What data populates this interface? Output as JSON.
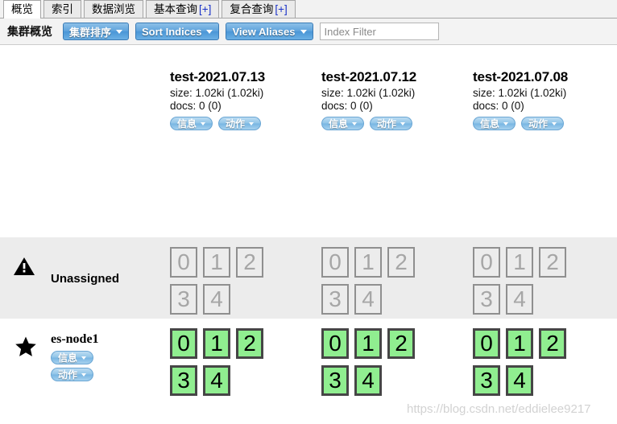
{
  "tabs": [
    {
      "label": "概览",
      "active": true,
      "plus": ""
    },
    {
      "label": "索引",
      "active": false,
      "plus": ""
    },
    {
      "label": "数据浏览",
      "active": false,
      "plus": ""
    },
    {
      "label": "基本查询",
      "active": false,
      "plus": "[+]"
    },
    {
      "label": "复合查询",
      "active": false,
      "plus": "[+]"
    }
  ],
  "toolbar": {
    "title": "集群概览",
    "buttons": [
      {
        "label": "集群排序",
        "icon": "chevron-down-icon"
      },
      {
        "label": "Sort Indices",
        "icon": "chevron-down-icon"
      },
      {
        "label": "View Aliases",
        "icon": "chevron-down-icon"
      }
    ],
    "filter": {
      "value": "",
      "placeholder": "Index Filter"
    }
  },
  "indices": [
    {
      "name": "test-2021.07.13",
      "size": "size: 1.02ki (1.02ki)",
      "docs": "docs: 0 (0)",
      "info_label": "信息",
      "action_label": "动作"
    },
    {
      "name": "test-2021.07.12",
      "size": "size: 1.02ki (1.02ki)",
      "docs": "docs: 0 (0)",
      "info_label": "信息",
      "action_label": "动作"
    },
    {
      "name": "test-2021.07.08",
      "size": "size: 1.02ki (1.02ki)",
      "docs": "docs: 0 (0)",
      "info_label": "信息",
      "action_label": "动作"
    }
  ],
  "rows": [
    {
      "id": "unassigned",
      "label": "Unassigned",
      "icon": "warning-triangle-icon",
      "shard_state": "unassigned",
      "columns": [
        [
          "0",
          "1",
          "2",
          "3",
          "4"
        ],
        [
          "0",
          "1",
          "2",
          "3",
          "4"
        ],
        [
          "0",
          "1",
          "2",
          "3",
          "4"
        ]
      ]
    },
    {
      "id": "es-node1",
      "label": "es-node1",
      "icon": "star-icon",
      "shard_state": "assigned",
      "info_label": "信息",
      "action_label": "动作",
      "columns": [
        [
          "0",
          "1",
          "2",
          "3",
          "4"
        ],
        [
          "0",
          "1",
          "2",
          "3",
          "4"
        ],
        [
          "0",
          "1",
          "2",
          "3",
          "4"
        ]
      ]
    }
  ],
  "watermark": "https://blog.csdn.net/eddielee9217",
  "colors": {
    "accent": "#4a96d6",
    "assigned_shard": "#90ee90",
    "unassigned_shard_border": "#8f8f8f",
    "shaded_row": "#ececec"
  }
}
